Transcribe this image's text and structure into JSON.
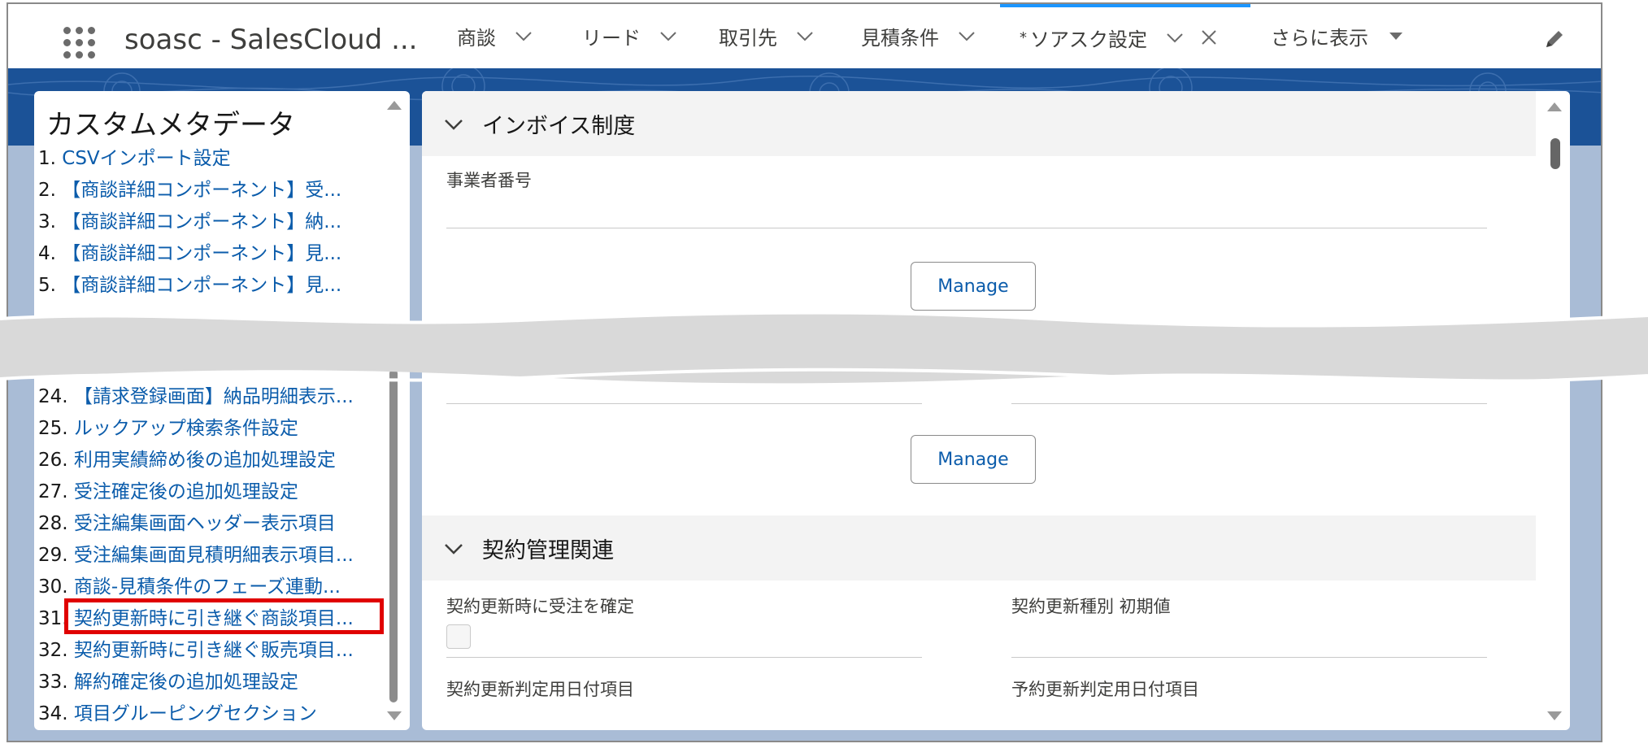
{
  "topnav": {
    "app_name": "soasc - SalesCloud ...",
    "tabs": [
      {
        "label": "商談"
      },
      {
        "label": "リード"
      },
      {
        "label": "取引先"
      },
      {
        "label": "見積条件"
      },
      {
        "label": "ソアスク設定",
        "modified_marker": "*",
        "active": true
      },
      {
        "label": "さらに表示"
      }
    ]
  },
  "left_panel": {
    "title": "カスタムメタデータ",
    "items_top": [
      {
        "num": "1.",
        "text": "CSVインポート設定"
      },
      {
        "num": "2.",
        "text": "【商談詳細コンポーネント】受..."
      },
      {
        "num": "3.",
        "text": "【商談詳細コンポーネント】納..."
      },
      {
        "num": "4.",
        "text": "【商談詳細コンポーネント】見..."
      },
      {
        "num": "5.",
        "text": "【商談詳細コンポーネント】見..."
      }
    ],
    "items_bottom": [
      {
        "num": "24.",
        "text": "【請求登録画面】納品明細表示..."
      },
      {
        "num": "25.",
        "text": "ルックアップ検索条件設定"
      },
      {
        "num": "26.",
        "text": "利用実績締め後の追加処理設定"
      },
      {
        "num": "27.",
        "text": "受注確定後の追加処理設定"
      },
      {
        "num": "28.",
        "text": "受注編集画面ヘッダー表示項目"
      },
      {
        "num": "29.",
        "text": "受注編集画面見積明細表示項目..."
      },
      {
        "num": "30.",
        "text": "商談-見積条件のフェーズ連動..."
      },
      {
        "num": "31.",
        "text": "契約更新時に引き継ぐ商談項目..."
      },
      {
        "num": "32.",
        "text": "契約更新時に引き継ぐ販売項目..."
      },
      {
        "num": "33.",
        "text": "解約確定後の追加処理設定"
      },
      {
        "num": "34.",
        "text": "項目グルーピングセクション"
      }
    ]
  },
  "right_panel": {
    "section1": {
      "title": "インボイス制度",
      "field_label": "事業者番号",
      "manage_label": "Manage"
    },
    "manage2_label": "Manage",
    "section2": {
      "title": "契約管理関連",
      "fields": [
        {
          "label": "契約更新時に受注を確定"
        },
        {
          "label": "契約更新種別 初期値"
        },
        {
          "label": "契約更新判定用日付項目"
        },
        {
          "label": "予約更新判定用日付項目"
        }
      ]
    }
  },
  "colors": {
    "link": "#0b5cab",
    "highlight": "#e00000",
    "brand_band": "#1b5297",
    "active_tab_border": "#1b96ff"
  }
}
